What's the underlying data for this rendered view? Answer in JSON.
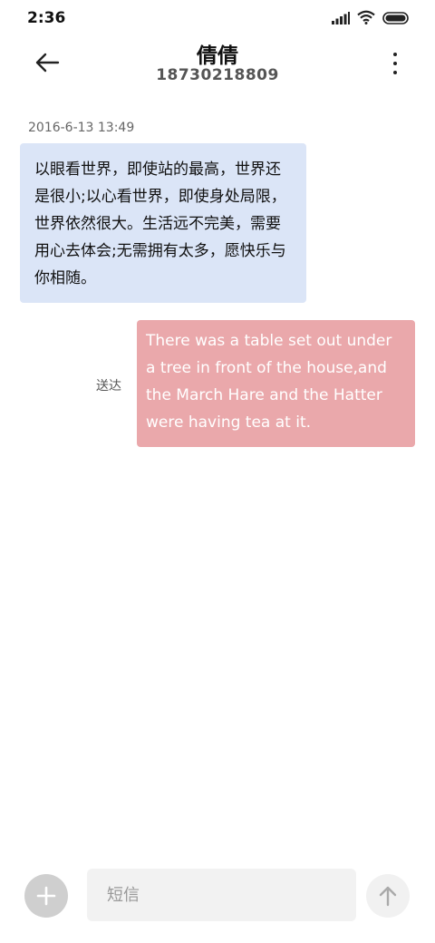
{
  "status_bar": {
    "time": "2:36",
    "icons": [
      "signal-icon",
      "wifi-icon",
      "battery-icon"
    ]
  },
  "header": {
    "contact_name": "倩倩",
    "contact_number": "18730218809",
    "back_icon": "arrow-left-icon",
    "menu_icon": "more-vertical-icon"
  },
  "conversation": {
    "timestamp": "2016-6-13 13:49",
    "messages": [
      {
        "direction": "incoming",
        "text": "以眼看世界，即使站的最高，世界还是很小;以心看世界，即使身处局限，世界依然很大。生活远不完美，需要用心去体会;无需拥有太多，愿快乐与你相随。"
      },
      {
        "direction": "outgoing",
        "text": "There was a table set out under a tree in front of the house,and the March Hare and the Hatter were having tea at it.",
        "status": "送达"
      }
    ]
  },
  "composer": {
    "placeholder": "短信",
    "value": "",
    "add_icon": "plus-icon",
    "send_icon": "arrow-up-icon"
  },
  "colors": {
    "incoming_bubble": "#dbe5f7",
    "outgoing_bubble": "#eaa8ab",
    "outgoing_text": "#ffffff"
  }
}
